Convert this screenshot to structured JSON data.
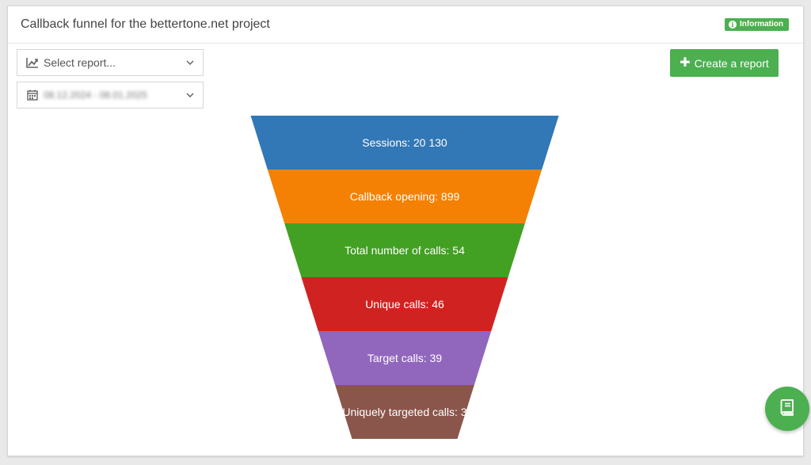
{
  "header": {
    "title": "Callback funnel for the bettertone.net project",
    "info_label": "Information"
  },
  "filters": {
    "report_placeholder": "Select report...",
    "date_range": "08.12.2024 - 08.01.2025"
  },
  "actions": {
    "create_report_label": "Create a report"
  },
  "icons": {
    "report_select": "line-chart-icon",
    "date_select": "calendar-icon",
    "dropdown": "chevron-down-icon",
    "info": "info-icon",
    "create": "plus-icon",
    "fab": "book-icon"
  },
  "colors": {
    "accent": "#4caf50"
  },
  "chart_data": {
    "type": "funnel",
    "stages": [
      {
        "label": "Sessions: 20 130",
        "name": "Sessions",
        "value": 20130,
        "color": "#3277b6"
      },
      {
        "label": "Callback opening: 899",
        "name": "Callback opening",
        "value": 899,
        "color": "#f48103"
      },
      {
        "label": "Total number of calls: 54",
        "name": "Total number of calls",
        "value": 54,
        "color": "#42a022"
      },
      {
        "label": "Unique calls: 46",
        "name": "Unique calls",
        "value": 46,
        "color": "#d02321"
      },
      {
        "label": "Target calls: 39",
        "name": "Target calls",
        "value": 39,
        "color": "#9167be"
      },
      {
        "label": "Uniquely targeted calls: 3",
        "name": "Uniquely targeted calls",
        "value": 3,
        "color": "#8a564b"
      }
    ]
  }
}
